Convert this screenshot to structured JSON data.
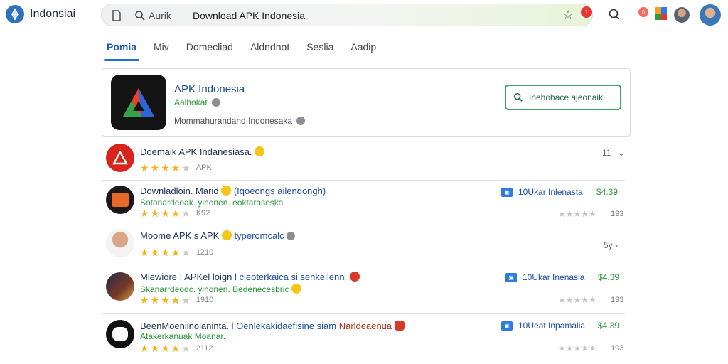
{
  "brand": {
    "name": "Indonsiai"
  },
  "search": {
    "hint": "Aurik",
    "value": "Download APK Indonesia",
    "badge": "1"
  },
  "topbar": {
    "notif": "0"
  },
  "tabs": [
    "Pomia",
    "Miv",
    "Domecliad",
    "Aldndnot",
    "Seslia",
    "Aadip"
  ],
  "app": {
    "name": "APK Indonesia",
    "developer": "Aalhokat",
    "subtitle": "Mommahurandand Indonesaka",
    "install_label": "Inehohace ajeonaik"
  },
  "results": [
    {
      "title": "Doemaik APK Indanesiasa.",
      "stars": 4,
      "count": "APK",
      "right_text": "11",
      "icon": "red-a-icon"
    },
    {
      "title": "Downladloin. Marid",
      "title_hl": "(Iqoeongs ailendongh)",
      "subtitle": "Sotanardeoak. yinonen. eoktaraseska",
      "stars": 4,
      "count": "K92",
      "tag": "10Ukar Inlenasta.",
      "price": "$4.39",
      "right_count": "193",
      "icon": "tablet-icon"
    },
    {
      "title": "Moome APK s APK",
      "title_hl": "typeromcalc",
      "stars": 4,
      "count": "1210",
      "right_text": "5y",
      "icon": "man-portrait-icon"
    },
    {
      "title": "Mlewiore : APKel loign",
      "title_hl": "l cleoterkaica si senkellenn.",
      "subtitle": "Skanarrdeodc. yinonen. Bedenecesbric",
      "stars": 4,
      "count": "1910",
      "tag": "10Ukar Inenasia",
      "price": "$4.39",
      "right_count": "193",
      "icon": "game-icon"
    },
    {
      "title": "BeenMoeniinolaninta.",
      "title_hl": "l Oenlekakidaefisine siam",
      "title_red": "Narldeaenua",
      "subtitle": "Atakerkanuak Moanar.",
      "stars": 4,
      "count": "2112",
      "tag": "10Ueat Inpamalia",
      "price": "$4.39",
      "right_count": "193",
      "icon": "robot-face-icon"
    }
  ],
  "colors": {
    "accent": "#1e6fd1",
    "green": "#2a9a3a",
    "star": "#f2b21a"
  }
}
